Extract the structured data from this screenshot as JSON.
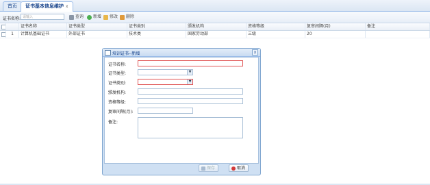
{
  "tabs": {
    "home": "首页",
    "active": "证书基本信息维护",
    "close": "x"
  },
  "toolbar": {
    "search_label": "证书名称:",
    "search_placeholder": "请输入",
    "query": "查询",
    "add": "新增",
    "edit": "修改",
    "delete": "删除"
  },
  "grid": {
    "columns": [
      "证书名称",
      "证书类型",
      "证书类别",
      "颁发机构",
      "资格等级",
      "复审间隔(月)",
      "备注"
    ],
    "rows": [
      {
        "index": "1",
        "name": "计算机基础证书",
        "type": "外部证书",
        "category": "技术类",
        "issuer": "国家劳动部",
        "level": "三级",
        "interval": "20",
        "note": ""
      }
    ]
  },
  "dialog": {
    "title": "培训证书--新增",
    "close": "x",
    "labels": {
      "name": "证书名称:",
      "type": "证书类型:",
      "category": "证书类别:",
      "issuer": "颁发机构:",
      "level": "资格等级:",
      "interval": "复审间隔(月):",
      "note": "备注:"
    },
    "values": {
      "name": "",
      "type": "",
      "category": "",
      "issuer": "",
      "level": "",
      "interval": "",
      "note": ""
    },
    "save": "保存",
    "cancel": "取消"
  },
  "colors": {
    "accent": "#15428b",
    "required_border": "#e05252",
    "frame": "#99bbe8"
  }
}
